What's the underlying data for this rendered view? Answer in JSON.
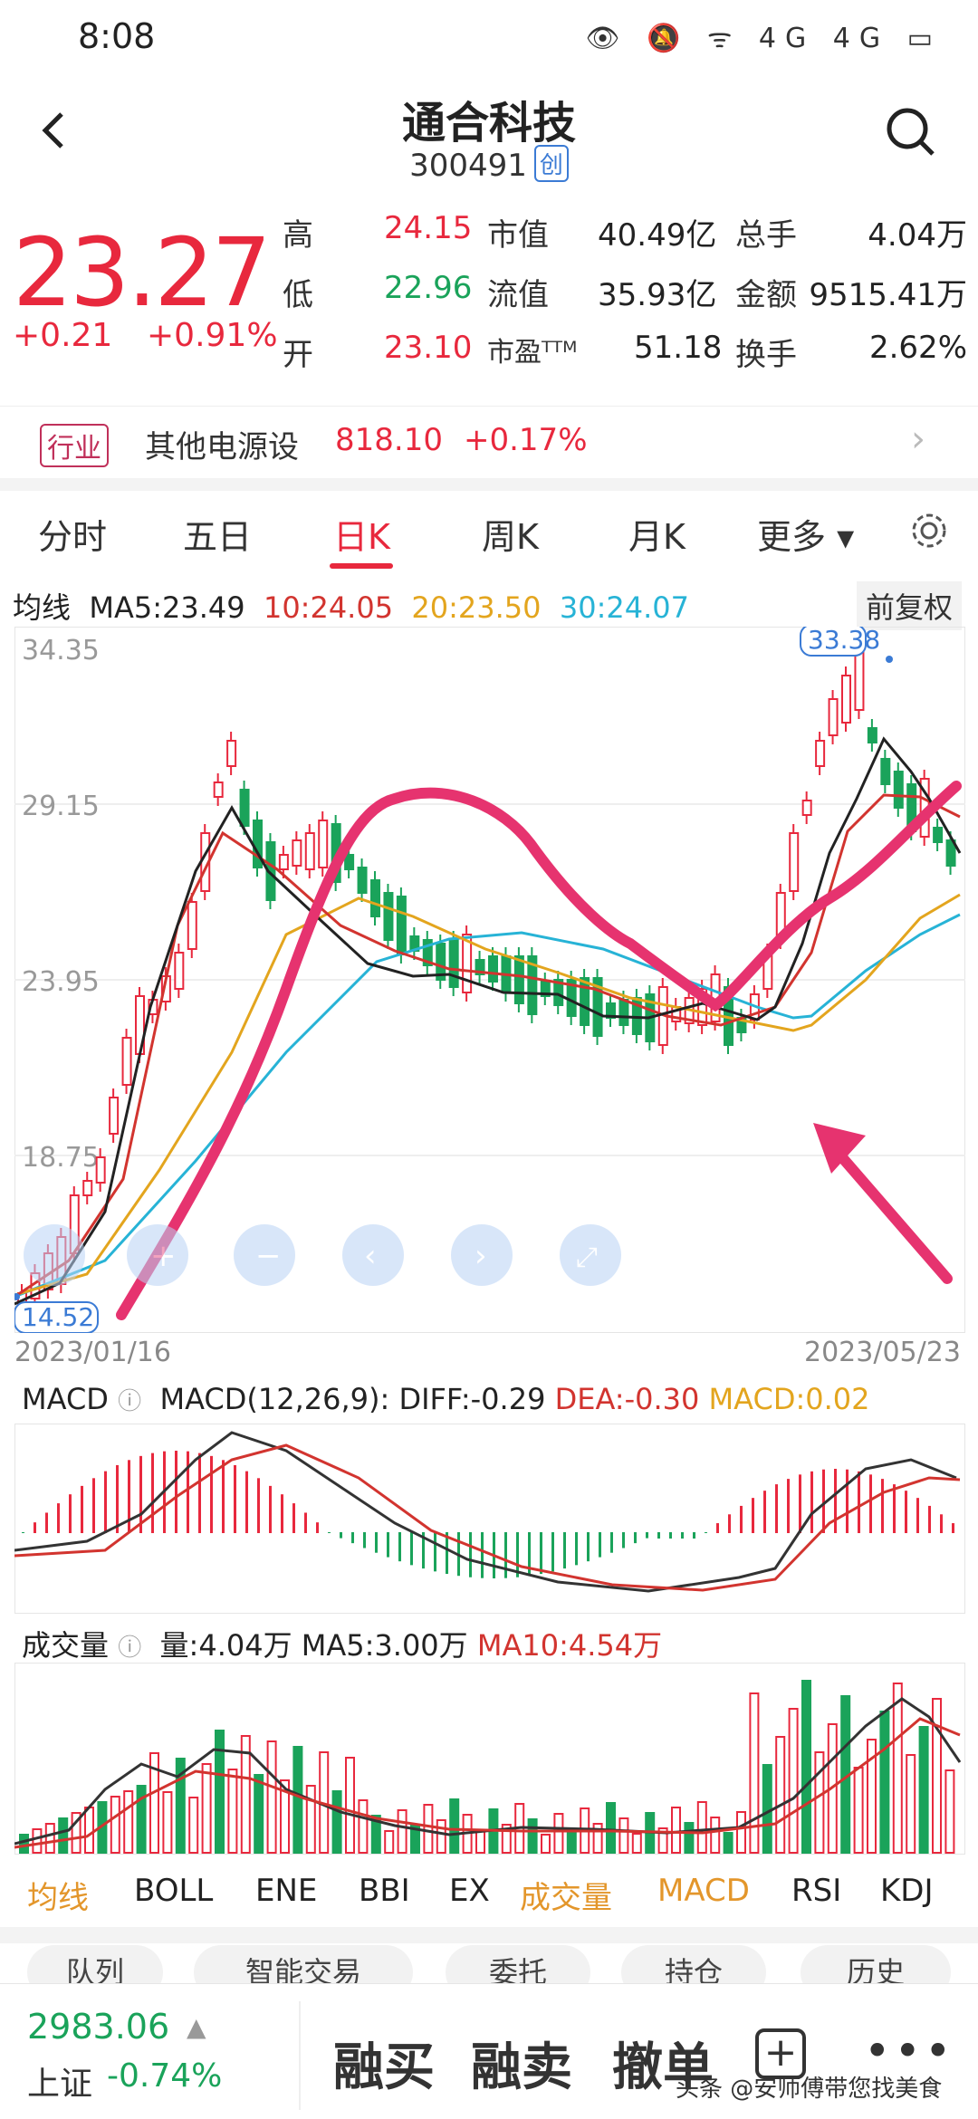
{
  "status_bar": {
    "time": "8:08",
    "icons": "👁 🔕 ᯤ 4G 4G ▭"
  },
  "header": {
    "back_icon": "chevron-left-icon",
    "title": "通合科技",
    "code": "300491",
    "board": "创",
    "search_icon": "search-icon"
  },
  "quote": {
    "price": "23.27",
    "change": "+0.21",
    "change_pct": "+0.91%",
    "rows": [
      {
        "l1": "高",
        "v1": "24.15",
        "l2": "市值",
        "v2": "40.49亿",
        "l3": "总手",
        "v3": "4.04万"
      },
      {
        "l1": "低",
        "v1": "22.96",
        "l2": "流值",
        "v2": "35.93亿",
        "l3": "金额",
        "v3": "9515.41万"
      },
      {
        "l1": "开",
        "v1": "23.10",
        "l2": "市盈ᵀᵀᴹ",
        "v2": "51.18",
        "l3": "换手",
        "v3": "2.62%"
      }
    ]
  },
  "industry": {
    "tag": "行业",
    "name": "其他电源设",
    "index": "818.10",
    "change": "+0.17%"
  },
  "tabs": [
    "分时",
    "五日",
    "日K",
    "周K",
    "月K",
    "更多 ▾"
  ],
  "chart": {
    "ma_label": "均线",
    "ma5": "MA5:23.49",
    "ma10": "10:24.05",
    "ma20": "20:23.50",
    "ma30": "30:24.07",
    "adjust": "前复权",
    "y_ticks": [
      "34.35",
      "29.15",
      "23.95",
      "18.75"
    ],
    "max_label": "33.38",
    "min_label": "14.52",
    "date_start": "2023/01/16",
    "date_end": "2023/05/23",
    "macd_title": "MACD",
    "macd_params": "MACD(12,26,9): DIFF:-0.29",
    "macd_dea": "DEA:-0.30",
    "macd_val": "MACD:0.02",
    "vol_title": "成交量",
    "vol_val": "量:4.04万",
    "vol_ma5": "MA5:3.00万",
    "vol_ma10": "MA10:4.54万",
    "colors": {
      "ma5": "#222222",
      "ma10": "#d2342f",
      "ma20": "#e3a51e",
      "ma30": "#27b3d6",
      "up": "#e8283d",
      "down": "#1aa35a",
      "annotation": "#e6336f"
    }
  },
  "indicator_tabs": [
    "均线",
    "BOLL",
    "ENE",
    "BBI",
    "EX",
    "成交量",
    "MACD",
    "RSI",
    "KDJ"
  ],
  "pills": [
    "队列",
    "智能交易",
    "委托",
    "持仓",
    "历史"
  ],
  "bottom": {
    "index_value": "2983.06",
    "index_name": "上证",
    "index_change": "-0.74%",
    "actions": [
      "融买",
      "融卖",
      "撤单"
    ],
    "watermark": "头条 @安师傅带您找美食"
  }
}
